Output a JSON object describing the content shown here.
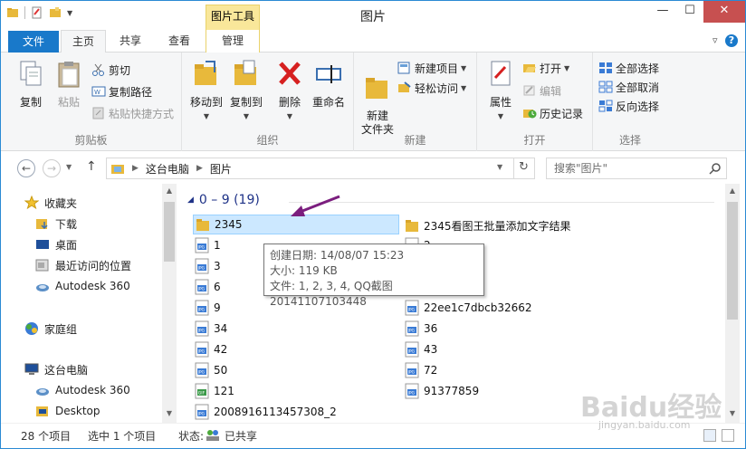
{
  "window": {
    "title": "图片",
    "tool_tab_header": "图片工具",
    "controls": {
      "minimize": "—",
      "maximize": "☐",
      "close": "✕"
    }
  },
  "tabs": {
    "file": "文件",
    "home": "主页",
    "share": "共享",
    "view": "查看",
    "manage": "管理"
  },
  "ribbon": {
    "clipboard": {
      "label": "剪贴板",
      "copy": "复制",
      "paste": "粘贴",
      "cut": "剪切",
      "copy_path": "复制路径",
      "paste_shortcut": "粘贴快捷方式"
    },
    "organize": {
      "label": "组织",
      "move_to": "移动到",
      "copy_to": "复制到",
      "delete": "删除",
      "rename": "重命名"
    },
    "new": {
      "label": "新建",
      "new_folder": "新建\n文件夹",
      "new_item": "新建项目",
      "easy_access": "轻松访问"
    },
    "open": {
      "label": "打开",
      "properties": "属性",
      "open": "打开",
      "edit": "编辑",
      "history": "历史记录"
    },
    "select": {
      "label": "选择",
      "select_all": "全部选择",
      "select_none": "全部取消",
      "invert": "反向选择"
    }
  },
  "address": {
    "path": [
      "这台电脑",
      "图片"
    ],
    "search_placeholder": "搜索\"图片\""
  },
  "nav_pane": {
    "favorites": "收藏夹",
    "downloads": "下载",
    "desktop": "桌面",
    "recent": "最近访问的位置",
    "autodesk1": "Autodesk 360",
    "homegroup": "家庭组",
    "this_pc": "这台电脑",
    "autodesk2": "Autodesk 360",
    "desktop2": "Desktop"
  },
  "content": {
    "group_header": "0 – 9 (19)",
    "files_left": [
      {
        "name": "2345",
        "type": "folder"
      },
      {
        "name": "1",
        "type": "jpg"
      },
      {
        "name": "3",
        "type": "jpg"
      },
      {
        "name": "6",
        "type": "jpg"
      },
      {
        "name": "9",
        "type": "jpg"
      },
      {
        "name": "34",
        "type": "jpg"
      },
      {
        "name": "42",
        "type": "jpg"
      },
      {
        "name": "50",
        "type": "jpg"
      },
      {
        "name": "121",
        "type": "gif"
      },
      {
        "name": "2008916113457308_2",
        "type": "jpg"
      }
    ],
    "files_right": [
      {
        "name": "2345看图王批量添加文字结果",
        "type": "folder"
      },
      {
        "name": "2",
        "type": "jpg"
      },
      {
        "name": "22ee1c7dbcb32662",
        "type": "jpg"
      },
      {
        "name": "36",
        "type": "jpg"
      },
      {
        "name": "43",
        "type": "jpg"
      },
      {
        "name": "72",
        "type": "jpg"
      },
      {
        "name": "91377859",
        "type": "jpg"
      }
    ],
    "tooltip": {
      "created": "创建日期: 14/08/07 15:23",
      "size": "大小: 119 KB",
      "files": "文件: 1, 2, 3, 4, QQ截图20141107103448"
    }
  },
  "status": {
    "count": "28 个项目",
    "selected": "选中 1 个项目",
    "state_label": "状态:",
    "state_value": "已共享"
  },
  "watermark": {
    "brand": "Baidu经验",
    "url": "jingyan.baidu.com"
  },
  "colors": {
    "accent": "#1979ca",
    "selection": "#cce8ff",
    "tool_tab": "#f9e79a",
    "group_header": "#1e3287",
    "arrow": "#7b1e7e"
  }
}
